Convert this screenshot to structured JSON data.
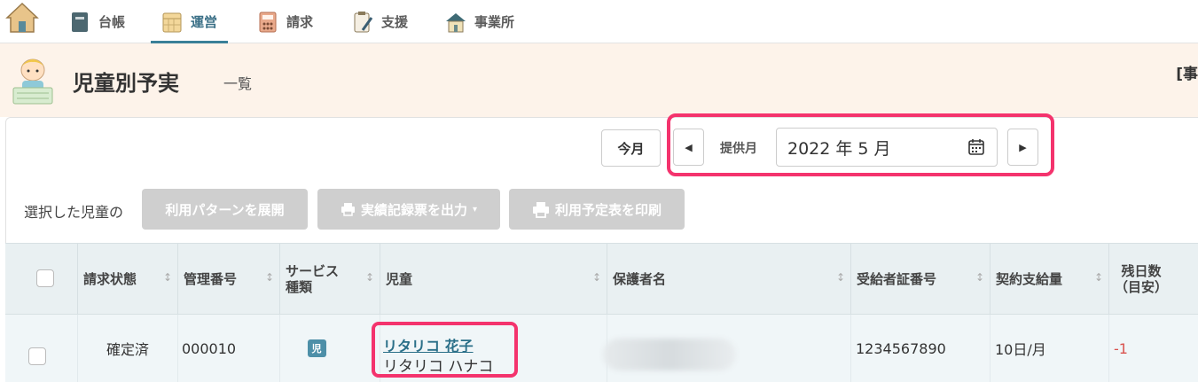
{
  "nav": {
    "items": [
      {
        "label": "台帳",
        "active": false
      },
      {
        "label": "運営",
        "active": true
      },
      {
        "label": "請求",
        "active": false
      },
      {
        "label": "支援",
        "active": false
      },
      {
        "label": "事業所",
        "active": false
      }
    ]
  },
  "header": {
    "title": "児童別予実",
    "subtitle": "一覧",
    "corner_text": "[事"
  },
  "toolbar": {
    "today_label": "今月",
    "prev_label": "◀",
    "next_label": "▶",
    "month_label": "提供月",
    "month_value": "2022 年 5 月"
  },
  "actions": {
    "selected_label": "選択した児童の",
    "pattern_label": "利用パターンを展開",
    "record_label": "実績記録票を出力",
    "print_label": "利用予定表を印刷"
  },
  "table": {
    "columns": [
      {
        "key": "status",
        "label": "請求状態"
      },
      {
        "key": "number",
        "label": "管理番号"
      },
      {
        "key": "service",
        "label": "サービス\n種類"
      },
      {
        "key": "child",
        "label": "児童"
      },
      {
        "key": "guardian",
        "label": "保護者名"
      },
      {
        "key": "cert",
        "label": "受給者証番号"
      },
      {
        "key": "amount",
        "label": "契約支給量"
      },
      {
        "key": "remaining",
        "label": "残日数\n（目安）"
      }
    ],
    "rows": [
      {
        "status": "確定済",
        "number": "000010",
        "service": "児",
        "child_name": "リタリコ 花子",
        "child_kana": "リタリコ ハナコ",
        "cert": "1234567890",
        "amount": "10日/月",
        "remaining": "-1"
      }
    ]
  },
  "colors": {
    "accent": "#3a7f98",
    "highlight": "#f4336d",
    "header_bg": "#fdf3ea"
  }
}
